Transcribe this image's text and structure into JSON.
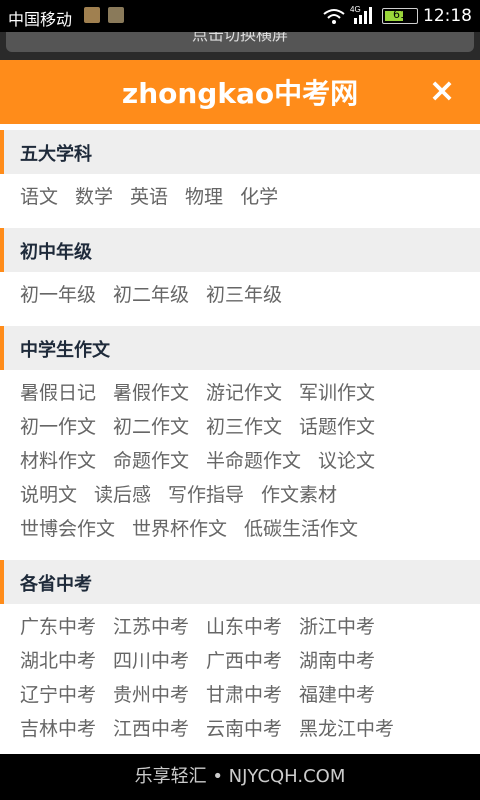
{
  "status": {
    "carrier": "中国移动",
    "net": "4G",
    "battery": "61",
    "time": "12:18"
  },
  "toast": {
    "label": "点击切换横屏"
  },
  "header": {
    "logo": "zhongkao中考网",
    "close": "×"
  },
  "sections": [
    {
      "title": "五大学科",
      "rows": [
        [
          "语文",
          "数学",
          "英语",
          "物理",
          "化学"
        ]
      ]
    },
    {
      "title": "初中年级",
      "rows": [
        [
          "初一年级",
          "初二年级",
          "初三年级"
        ]
      ]
    },
    {
      "title": "中学生作文",
      "rows": [
        [
          "暑假日记",
          "暑假作文",
          "游记作文",
          "军训作文"
        ],
        [
          "初一作文",
          "初二作文",
          "初三作文",
          "话题作文"
        ],
        [
          "材料作文",
          "命题作文",
          "半命题作文",
          "议论文"
        ],
        [
          "说明文",
          "读后感",
          "写作指导",
          "作文素材"
        ],
        [
          "世博会作文",
          "世界杯作文",
          "低碳生活作文"
        ]
      ]
    },
    {
      "title": "各省中考",
      "rows": [
        [
          "广东中考",
          "江苏中考",
          "山东中考",
          "浙江中考"
        ],
        [
          "湖北中考",
          "四川中考",
          "广西中考",
          "湖南中考"
        ],
        [
          "辽宁中考",
          "贵州中考",
          "甘肃中考",
          "福建中考"
        ],
        [
          "吉林中考",
          "江西中考",
          "云南中考",
          "黑龙江中考"
        ]
      ]
    }
  ],
  "footer": {
    "watermark": "乐享轻汇 • NJYCQH.COM"
  }
}
